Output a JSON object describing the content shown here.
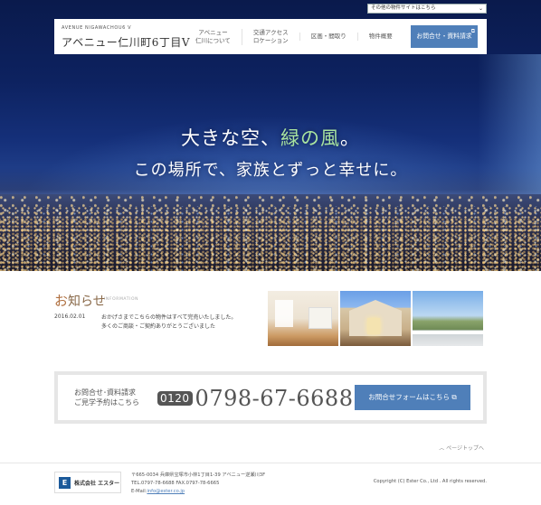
{
  "top_select": {
    "value": "その他の物件サイトはこちら"
  },
  "header": {
    "logo_small": "AVENUE NIGAWACHOU6 V",
    "logo_main": "アベニュー仁川町6丁目V",
    "nav": [
      {
        "line1": "アベニュー",
        "line2": "仁川について"
      },
      {
        "line1": "交通アクセス",
        "line2": "ロケーション"
      },
      {
        "line1": "区画・間取り",
        "line2": ""
      },
      {
        "line1": "物件概要",
        "line2": ""
      }
    ],
    "cta_label": "お問合せ・資料請求"
  },
  "hero": {
    "line1_pre": "大きな空、",
    "line1_accent": "緑の風",
    "line1_post": "。",
    "line2": "この場所で、家族とずっと幸せに。"
  },
  "news": {
    "title_first": "お",
    "title_rest": "知らせ",
    "subtitle": "INFORMATION",
    "date": "2016.02.01",
    "text_line1": "おかげさまでこちらの物件はすべて完売いたしました。",
    "text_line2": "多くのご商談・ご契約ありがとうございました"
  },
  "contact": {
    "label_line1": "お問合せ･資料請求",
    "label_line2": "ご見学予約はこちら",
    "freedial": "0120",
    "phone": "0798-67-6688",
    "button_label": "お問合せフォームはこちら"
  },
  "pagetop": "ページトップへ",
  "footer": {
    "company": "株式会社 エスター",
    "address_line1": "〒665-0034 兵庫県宝塚市小林1丁目1-39 アベニュー逆瀬川3F",
    "address_line2": "TEL.0797-78-6688 FAX.0797-78-6665",
    "email_label": "E-Mail:",
    "email": "info@ester.co.jp",
    "copyright": "Copyright (C) Ester Co., Ltd . All rights reserved."
  },
  "colors": {
    "accent_blue": "#4f7fb9",
    "hero_accent_green": "#a9e4a0",
    "news_title_brown": "#b07040"
  }
}
